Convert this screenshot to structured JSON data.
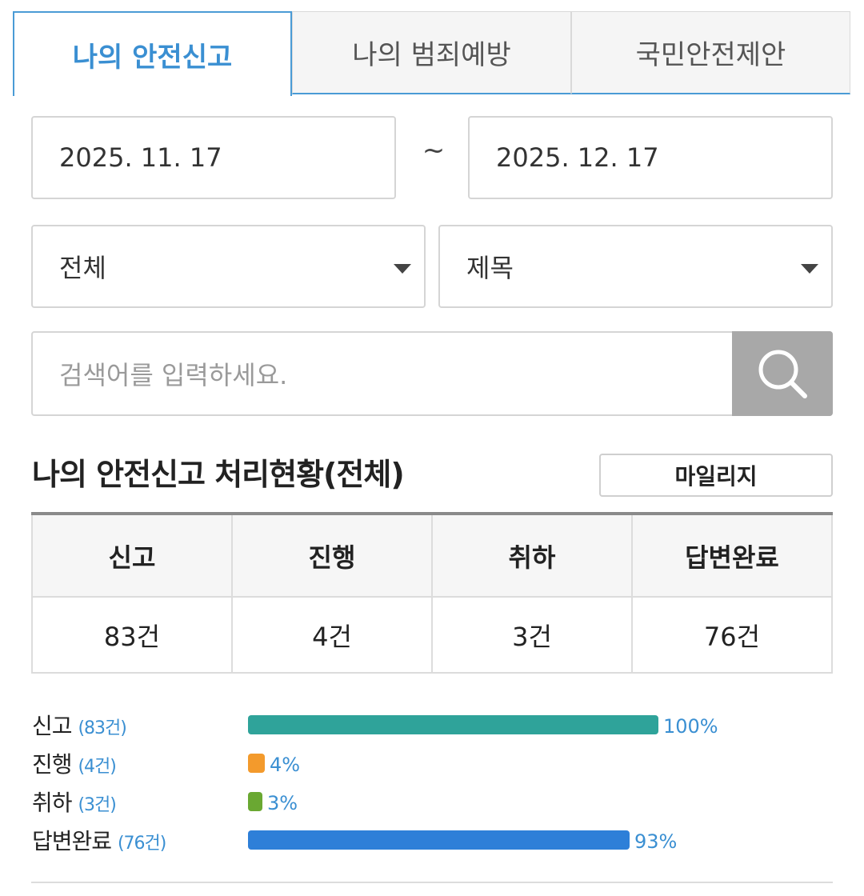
{
  "tabs": [
    {
      "label": "나의 안전신고",
      "active": true
    },
    {
      "label": "나의 범죄예방",
      "active": false
    },
    {
      "label": "국민안전제안",
      "active": false
    }
  ],
  "filters": {
    "date_start": "2025. 11. 17",
    "date_separator": "~",
    "date_end": "2025. 12. 17",
    "category_selected": "전체",
    "field_selected": "제목",
    "search_placeholder": "검색어를 입력하세요."
  },
  "section": {
    "title": "나의 안전신고 처리현황(전체)",
    "mileage_button": "마일리지"
  },
  "stats_table": {
    "headers": [
      "신고",
      "진행",
      "취하",
      "답변완료"
    ],
    "values": [
      "83건",
      "4건",
      "3건",
      "76건"
    ]
  },
  "progress": [
    {
      "label": "신고",
      "count": "(83건)",
      "percent_text": "100%",
      "fraction": 1.0,
      "color": "#2fa39a"
    },
    {
      "label": "진행",
      "count": "(4건)",
      "percent_text": "4%",
      "fraction": 0.04,
      "color": "#f39a2c"
    },
    {
      "label": "취하",
      "count": "(3건)",
      "percent_text": "3%",
      "fraction": 0.03,
      "color": "#6aa832"
    },
    {
      "label": "답변완료",
      "count": "(76건)",
      "percent_text": "93%",
      "fraction": 0.93,
      "color": "#2e7fd8"
    }
  ],
  "colors": {
    "accent": "#3a8fd2",
    "search_button": "#a8a8a8"
  },
  "icons": {
    "search": "search-icon",
    "dropdown": "chevron-down-icon"
  }
}
